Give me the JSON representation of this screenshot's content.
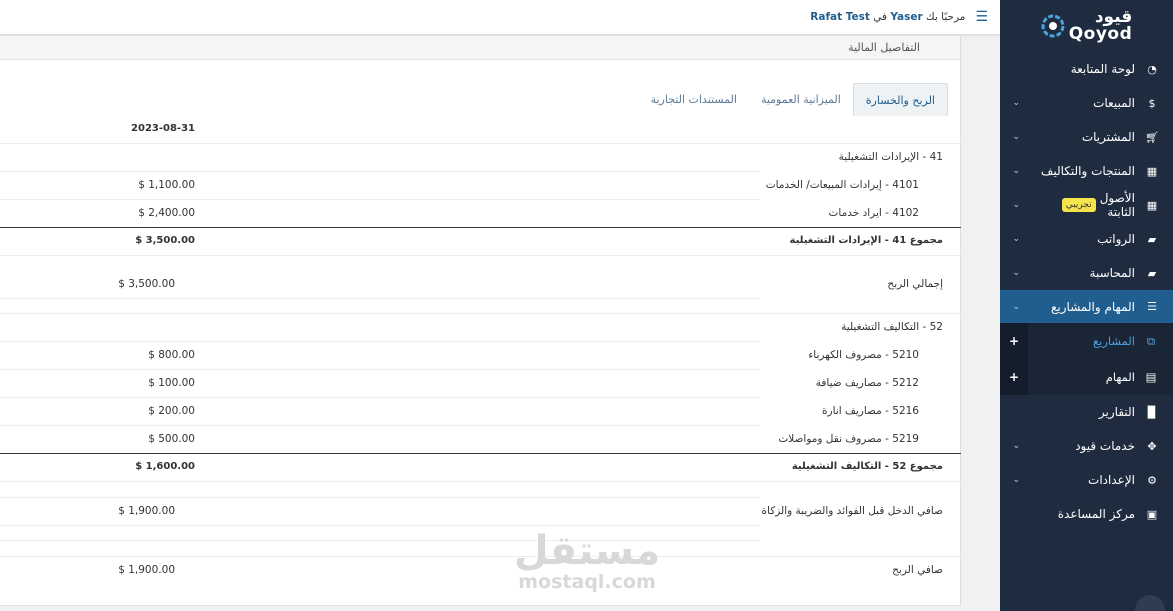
{
  "brand": {
    "name_ar": "قيود",
    "name_en": "Qoyod"
  },
  "topbar": {
    "welcome_prefix": "مرحبًا بك",
    "user": "Yaser",
    "in": "في",
    "company": "Rafat Test"
  },
  "panel": {
    "title": "التفاصيل المالية"
  },
  "tabs": [
    {
      "label": "الربح والخسارة",
      "active": true
    },
    {
      "label": "الميزانية العمومية",
      "active": false
    },
    {
      "label": "المستندات التجارية",
      "active": false
    }
  ],
  "report": {
    "date_header": "2023-08-31",
    "rows": [
      {
        "label": "41 - الإيرادات التشغيلية",
        "amount": ""
      },
      {
        "label": "4101 - إيرادات المبيعات/ الخدمات",
        "amount": "$ 1,100.00"
      },
      {
        "label": "4102 - ايراد خدمات",
        "amount": "$ 2,400.00"
      },
      {
        "label": "مجموع 41 - الإيرادات التشغيلية",
        "amount": "$ 3,500.00"
      },
      {
        "label": "إجمالي الربح",
        "amount": "$ 3,500.00"
      },
      {
        "label": "52 - التكاليف التشغيلية",
        "amount": ""
      },
      {
        "label": "5210 - مصروف الكهرباء",
        "amount": "$ 800.00"
      },
      {
        "label": "5212 - مصاريف ضيافة",
        "amount": "$ 100.00"
      },
      {
        "label": "5216 - مصاريف انارة",
        "amount": "$ 200.00"
      },
      {
        "label": "5219 - مصروف نقل ومواصلات",
        "amount": "$ 500.00"
      },
      {
        "label": "مجموع 52 - التكاليف التشغيلية",
        "amount": "$ 1,600.00"
      },
      {
        "label": "صافي الدخل قبل الفوائد والضريبة والزكاة",
        "amount": "$ 1,900.00"
      },
      {
        "label": "صافي الربح",
        "amount": "$ 1,900.00"
      }
    ]
  },
  "sidebar": {
    "items": [
      {
        "label": "لوحة المتابعة",
        "icon": "dashboard-icon"
      },
      {
        "label": "المبيعات",
        "icon": "dollar-icon"
      },
      {
        "label": "المشتريات",
        "icon": "cart-icon"
      },
      {
        "label": "المنتجات والتكاليف",
        "icon": "grid-icon"
      },
      {
        "label": "الأصول الثابتة",
        "icon": "grid-icon",
        "badge": "تجريبي"
      },
      {
        "label": "الرواتب",
        "icon": "folder-icon"
      },
      {
        "label": "المحاسبة",
        "icon": "folder-icon"
      },
      {
        "label": "المهام والمشاريع",
        "icon": "list-icon"
      },
      {
        "label": "التقارير",
        "icon": "file-icon"
      },
      {
        "label": "خدمات قيود",
        "icon": "puzzle-icon"
      },
      {
        "label": "الإعدادات",
        "icon": "gear-icon"
      },
      {
        "label": "مركز المساعدة",
        "icon": "calendar-icon"
      }
    ],
    "sub_items": [
      {
        "label": "المشاريع",
        "icon": "sitemap-icon",
        "current": true
      },
      {
        "label": "المهام",
        "icon": "tasks-icon",
        "current": false
      }
    ],
    "plus": "+"
  },
  "watermark": {
    "ar": "مستقل",
    "en": "mostaql.com"
  },
  "colors": {
    "sidebar": "#1f2b3e",
    "accent": "#1f5e8f",
    "badge": "#f5e44a"
  }
}
